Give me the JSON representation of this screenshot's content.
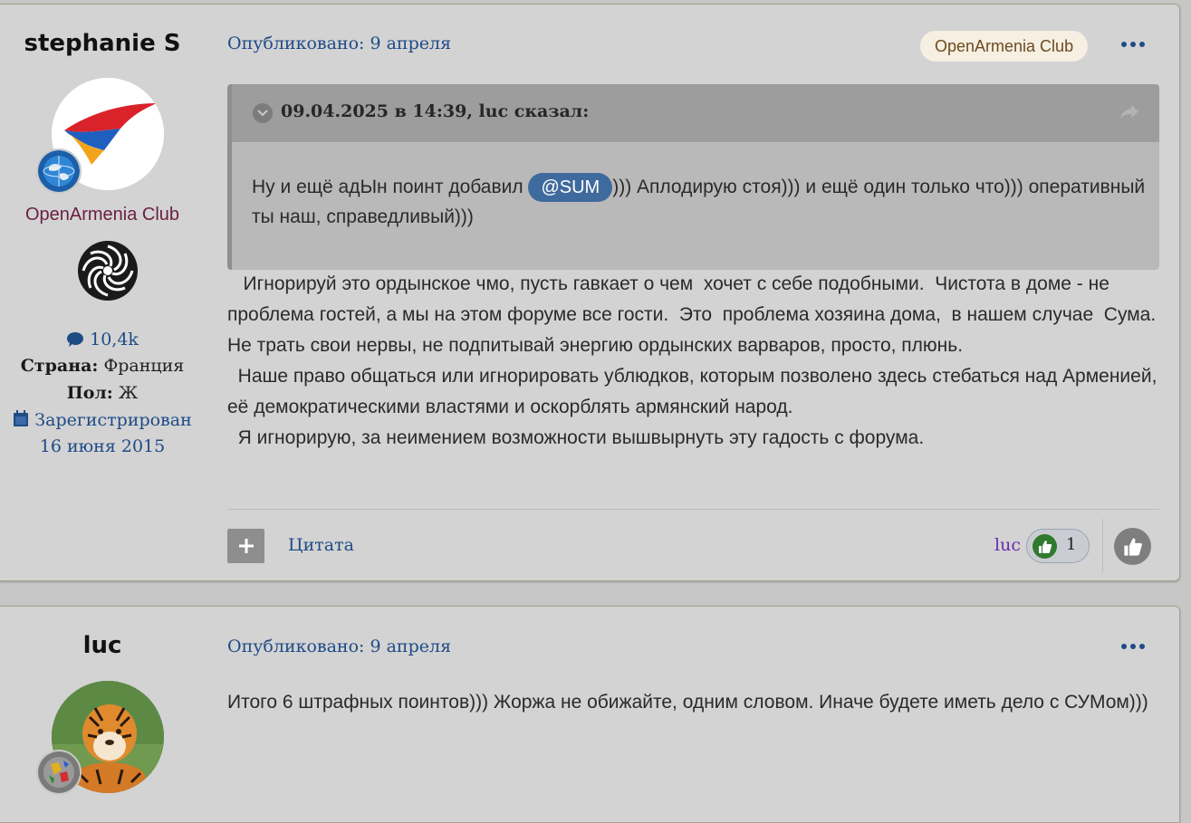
{
  "posts": [
    {
      "author": "stephanie S",
      "group": "OpenArmenia Club",
      "post_count": "10,4k",
      "country_label": "Страна:",
      "country": "Франция",
      "gender_label": "Пол:",
      "gender": "Ж",
      "registered_label": "Зарегистрирован",
      "registered_date": "16 июня 2015",
      "published": "Опубликовано: 9 апреля",
      "club_badge": "OpenArmenia Club",
      "quote": {
        "citation": "09.04.2025 в 14:39, luc сказал:",
        "text_before": "Ну и ещё адЫн поинт добавил",
        "mention": "@SUM",
        "text_after": "))) Аплодирую стоя))) и ещё один только что))) оперативный ты наш, справедливый)))"
      },
      "paragraphs": [
        "   Игнорируй это ордынское чмо, пусть гавкает о чем  хочет с себе подобными.  Чистота в доме - не проблема гостей, а мы на этом форуме все гости.  Это  проблема хозяина дома,  в нашем случае  Сума.  Не трать свои нервы, не подпитывай энергию ордынских варваров, просто, плюнь.",
        "  Наше право общаться или игнорировать ублюдков, которым позволено здесь стебаться над Арменией,  её демократическими властями и оскорблять армянский народ.",
        "  Я игнорирую, за неимением возможности вышвырнуть эту гадость с форума."
      ],
      "quote_button": "Цитата",
      "reaction_user": "luc",
      "reaction_count": "1"
    },
    {
      "author": "luc",
      "published": "Опубликовано: 9 апреля",
      "paragraphs": [
        "Итого 6 штрафных поинтов))) Жоржа не обижайте, одним словом. Иначе будете иметь дело с СУМом)))"
      ]
    }
  ],
  "colors": {
    "link": "#1e4b86",
    "group": "#6a1f3f",
    "reaction_user": "#6a2aa8",
    "badge_bg": "#f6efe2",
    "mention_bg": "#3f6a9d"
  },
  "icons": [
    "speech-bubble-icon",
    "calendar-icon",
    "chevron-down-icon",
    "share-icon",
    "plus-icon",
    "thumbs-up-icon",
    "more-options-icon"
  ]
}
